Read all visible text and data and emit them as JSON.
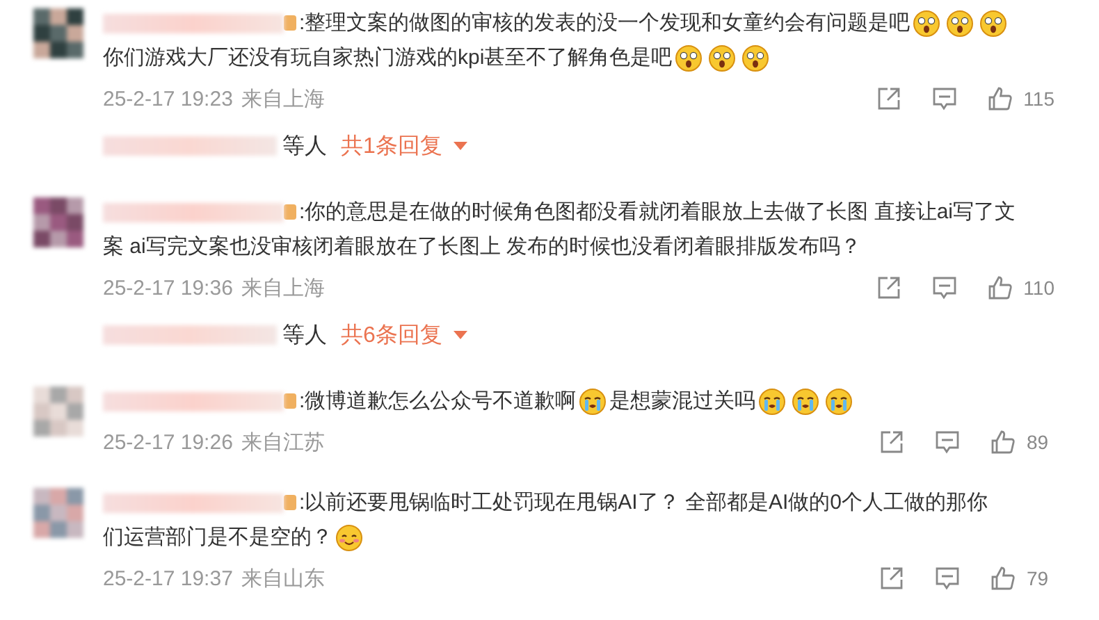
{
  "comments": [
    {
      "lines": [
        [
          {
            "kind": "text",
            "text": ":整理文案的做图的审核的发表的没一个发现和女童约会有问题是吧"
          },
          {
            "kind": "shocked"
          },
          {
            "kind": "shocked"
          },
          {
            "kind": "shocked"
          }
        ],
        [
          {
            "kind": "text",
            "text": "你们游戏大厂还没有玩自家热门游戏的kpi甚至不了解角色是吧"
          },
          {
            "kind": "shocked"
          },
          {
            "kind": "shocked"
          },
          {
            "kind": "shocked"
          }
        ]
      ],
      "time": "25-2-17 19:23",
      "location": "来自上海",
      "likes": "115",
      "replies": {
        "suffix": "等人",
        "count": "共1条回复"
      }
    },
    {
      "lines": [
        [
          {
            "kind": "text",
            "text": ":你的意思是在做的时候角色图都没看就闭着眼放上去做了长图 直接让ai写了文"
          }
        ],
        [
          {
            "kind": "text",
            "text": "案 ai写完文案也没审核闭着眼放在了长图上 发布的时候也没看闭着眼排版发布吗？"
          }
        ]
      ],
      "time": "25-2-17 19:36",
      "location": "来自上海",
      "likes": "110",
      "replies": {
        "suffix": "等人",
        "count": "共6条回复"
      }
    },
    {
      "lines": [
        [
          {
            "kind": "text",
            "text": ":微博道歉怎么公众号不道歉啊"
          },
          {
            "kind": "crying"
          },
          {
            "kind": "text",
            "text": "是想蒙混过关吗"
          },
          {
            "kind": "crying"
          },
          {
            "kind": "crying"
          },
          {
            "kind": "crying"
          }
        ]
      ],
      "time": "25-2-17 19:26",
      "location": "来自江苏",
      "likes": "89"
    },
    {
      "lines": [
        [
          {
            "kind": "text",
            "text": ":以前还要甩锅临时工处罚现在甩锅AI了？ 全部都是AI做的0个人工做的那你"
          }
        ],
        [
          {
            "kind": "text",
            "text": "们运营部门是不是空的？"
          },
          {
            "kind": "shy"
          }
        ]
      ],
      "time": "25-2-17 19:37",
      "location": "来自山东",
      "likes": "79"
    }
  ]
}
